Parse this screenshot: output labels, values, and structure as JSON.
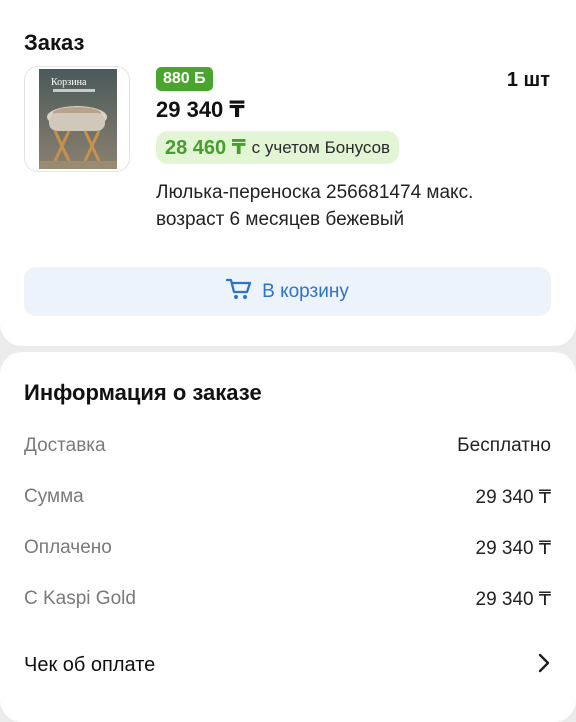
{
  "order": {
    "title": "Заказ",
    "bonus_badge": "880 Б",
    "quantity": "1 шт",
    "price": "29 340 ₸",
    "bonus_price": "28 460 ₸",
    "bonus_note": "с учетом Бонусов",
    "product_name": "Люлька-переноска 256681474 макс. возраст 6 месяцев бежевый",
    "cart_button_label": "В корзину",
    "thumbnail_caption": "Корзина"
  },
  "info": {
    "title": "Информация о заказе",
    "rows": [
      {
        "label": "Доставка",
        "value": "Бесплатно"
      },
      {
        "label": "Сумма",
        "value": "29 340 ₸"
      },
      {
        "label": "Оплачено",
        "value": "29 340 ₸"
      },
      {
        "label": "С Kaspi Gold",
        "value": "29 340 ₸"
      }
    ],
    "receipt_label": "Чек об оплате"
  },
  "colors": {
    "bonus_green": "#4aa52e",
    "bonus_pill_bg": "#e2f5d4",
    "accent_blue": "#2e73c8",
    "button_bg": "#edf3fb"
  },
  "icons": {
    "cart": "cart-icon",
    "chevron": "chevron-right-icon"
  }
}
